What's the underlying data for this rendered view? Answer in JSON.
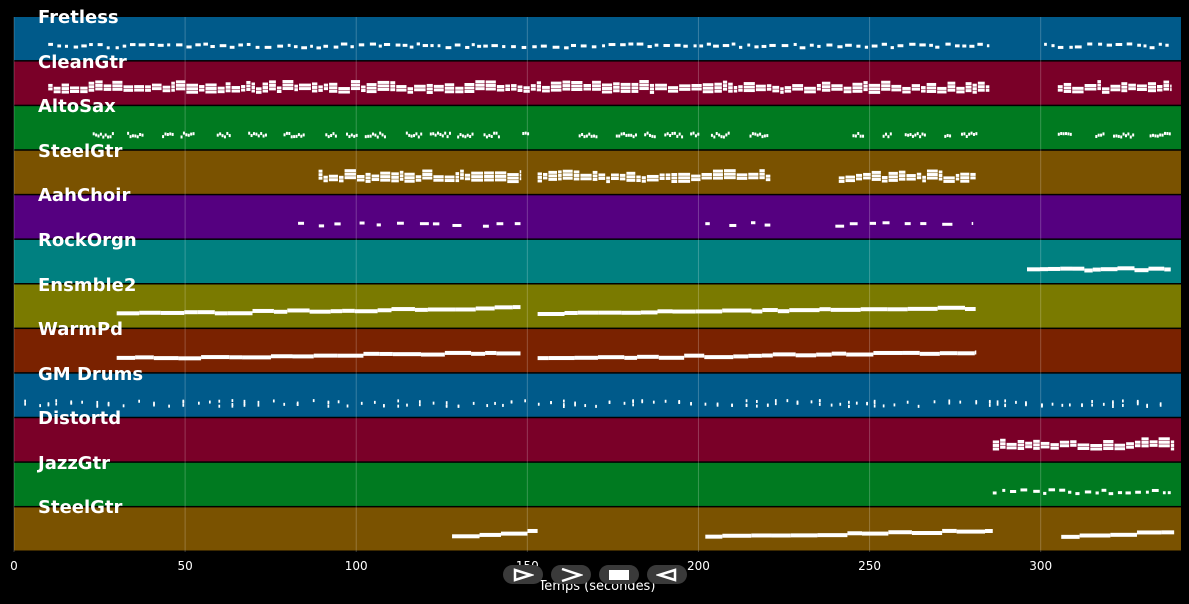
{
  "chart_data": {
    "type": "piano-roll",
    "xlabel": "Temps (secondes)",
    "xlim": [
      0,
      341
    ],
    "xticks": [
      0,
      50,
      100,
      150,
      200,
      250,
      300
    ],
    "grid": true,
    "tracks": [
      {
        "name": "Fretless",
        "color": "#005a8a",
        "pattern": "dense",
        "segments": [
          [
            10,
            285
          ],
          [
            301,
            338
          ]
        ]
      },
      {
        "name": "CleanGtr",
        "color": "#7a0028",
        "pattern": "chords",
        "segments": [
          [
            10,
            285
          ],
          [
            305,
            338
          ]
        ]
      },
      {
        "name": "AltoSax",
        "color": "#007a20",
        "pattern": "phrases",
        "segments": [
          [
            23,
            150
          ],
          [
            165,
            225
          ],
          [
            245,
            282
          ],
          [
            305,
            338
          ]
        ]
      },
      {
        "name": "SteelGtr",
        "color": "#7a5200",
        "pattern": "chords",
        "segments": [
          [
            89,
            148
          ],
          [
            153,
            221
          ],
          [
            241,
            281
          ]
        ]
      },
      {
        "name": "AahChoir",
        "color": "#550080",
        "pattern": "sparse",
        "segments": [
          [
            83,
            148
          ],
          [
            202,
            221
          ],
          [
            240,
            280
          ]
        ]
      },
      {
        "name": "RockOrgn",
        "color": "#008080",
        "pattern": "block",
        "segments": [
          [
            296,
            338
          ]
        ]
      },
      {
        "name": "Ensmble2",
        "color": "#7a7a00",
        "pattern": "sustain",
        "segments": [
          [
            30,
            148
          ],
          [
            153,
            281
          ]
        ]
      },
      {
        "name": "WarmPd",
        "color": "#7a2200",
        "pattern": "sustain",
        "segments": [
          [
            30,
            148
          ],
          [
            153,
            281
          ]
        ]
      },
      {
        "name": "GM Drums",
        "color": "#005a8a",
        "pattern": "drums",
        "segments": [
          [
            3,
            338
          ]
        ]
      },
      {
        "name": "Distortd",
        "color": "#7a0028",
        "pattern": "chords",
        "segments": [
          [
            286,
            339
          ]
        ]
      },
      {
        "name": "JazzGtr",
        "color": "#007a20",
        "pattern": "dense",
        "segments": [
          [
            286,
            338
          ]
        ]
      },
      {
        "name": "SteelGtr",
        "color": "#7a5200",
        "pattern": "sustain",
        "segments": [
          [
            128,
            153
          ],
          [
            202,
            286
          ],
          [
            306,
            339
          ]
        ]
      }
    ]
  },
  "controls": [
    {
      "name": "play-button",
      "icon": "play-icon"
    },
    {
      "name": "forward-button",
      "icon": "chevron-right-icon"
    },
    {
      "name": "stop-button",
      "icon": "stop-icon"
    },
    {
      "name": "back-button",
      "icon": "rewind-icon"
    }
  ]
}
